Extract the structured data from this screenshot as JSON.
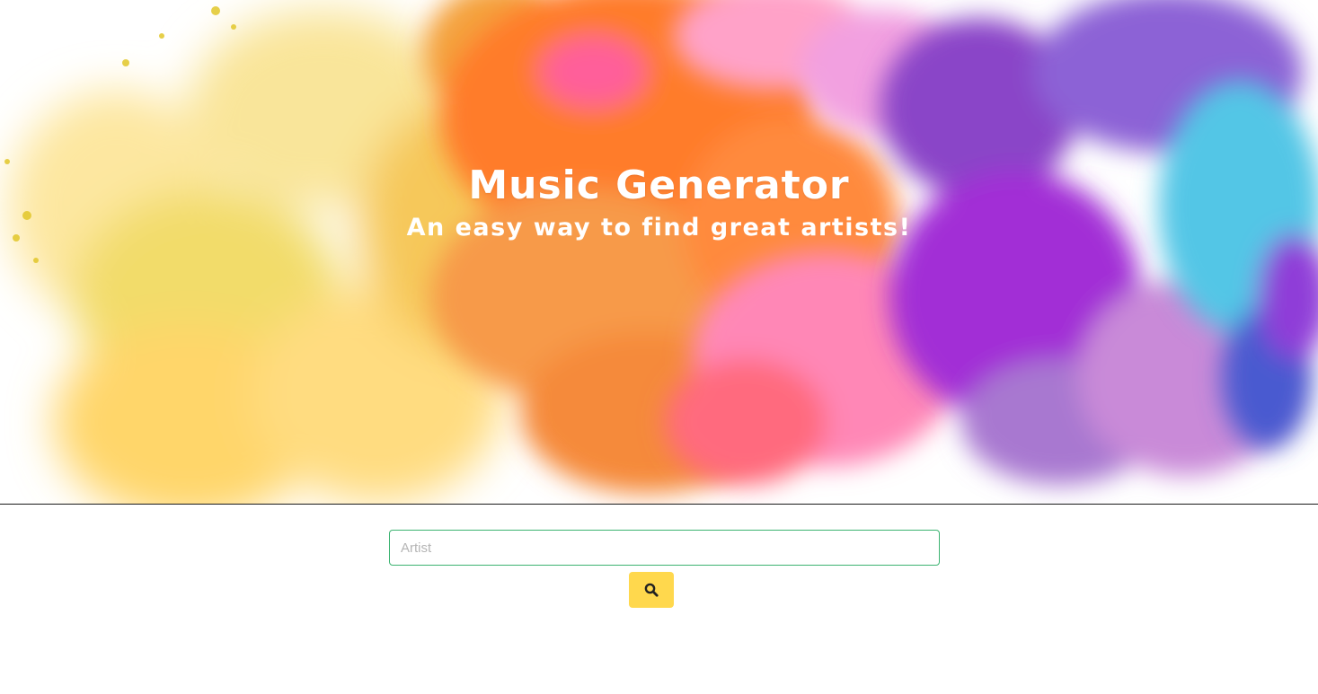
{
  "hero": {
    "title": "Music Generator",
    "subtitle": "An easy way to find great artists!",
    "paint_colors": [
      "#f3d23e",
      "#ffd35c",
      "#ff7a2e",
      "#ff6fa8",
      "#a72fd4",
      "#6a3cc4",
      "#4fc8e8"
    ]
  },
  "search": {
    "placeholder": "Artist",
    "value": "",
    "button_icon": "search-icon",
    "button_color": "#ffd84d",
    "border_color": "#3cb371"
  }
}
